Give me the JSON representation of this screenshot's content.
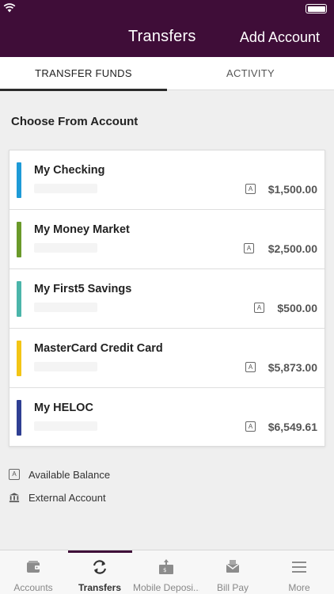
{
  "header": {
    "title": "Transfers",
    "add_account": "Add Account",
    "background": "#3f0d38"
  },
  "tabs": [
    {
      "label": "TRANSFER FUNDS",
      "active": true
    },
    {
      "label": "ACTIVITY",
      "active": false
    }
  ],
  "section_title": "Choose From Account",
  "accounts": [
    {
      "name": "My Checking",
      "badge": "A",
      "balance": "$1,500.00",
      "color": "#1e9bd7"
    },
    {
      "name": "My Money Market",
      "badge": "A",
      "balance": "$2,500.00",
      "color": "#6a9a2a"
    },
    {
      "name": "My First5 Savings",
      "badge": "A",
      "balance": "$500.00",
      "color": "#4bb5aa"
    },
    {
      "name": "MasterCard Credit Card",
      "badge": "A",
      "balance": "$5,873.00",
      "color": "#f3c515"
    },
    {
      "name": "My HELOC",
      "badge": "A",
      "balance": "$6,549.61",
      "color": "#2f3f93"
    }
  ],
  "legend": {
    "available_badge": "A",
    "available_label": "Available Balance",
    "external_icon": "bank-icon",
    "external_label": "External Account"
  },
  "bottom_nav": [
    {
      "label": "Accounts",
      "icon": "wallet-icon",
      "active": false
    },
    {
      "label": "Transfers",
      "icon": "transfer-arrows-icon",
      "active": true
    },
    {
      "label": "Mobile Deposi...",
      "icon": "mobile-deposit-icon",
      "active": false
    },
    {
      "label": "Bill Pay",
      "icon": "bill-pay-icon",
      "active": false
    },
    {
      "label": "More",
      "icon": "menu-icon",
      "active": false
    }
  ]
}
